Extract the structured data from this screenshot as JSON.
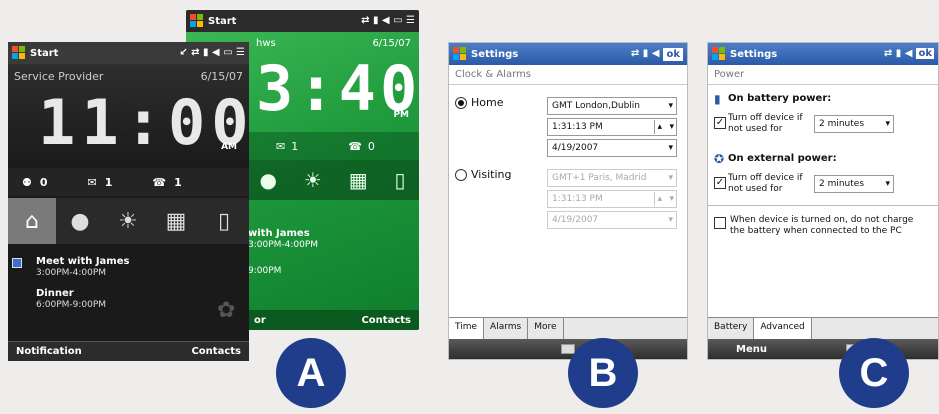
{
  "phoneA_back": {
    "title": "Start",
    "date": "6/15/07",
    "clock": "3:40",
    "clock_ampm": "PM",
    "sub_label": "hws",
    "counts": [
      "1",
      "0"
    ],
    "appt1": "with James",
    "appt1_time": "3:00PM-4:00PM",
    "appt2_time": "9:00PM",
    "soft_left": "or",
    "soft_right": "Contacts"
  },
  "phoneA_front": {
    "title": "Start",
    "provider": "Service Provider",
    "date": "6/15/07",
    "clock": "11:00",
    "clock_ampm": "AM",
    "counts": [
      "0",
      "1",
      "1"
    ],
    "appt1_title": "Meet with James",
    "appt1_time": "3:00PM-4:00PM",
    "appt2_title": "Dinner",
    "appt2_time": "6:00PM-9:00PM",
    "soft_left": "Notification",
    "soft_right": "Contacts"
  },
  "phoneB": {
    "title": "Settings",
    "ok": "ok",
    "crumb": "Clock & Alarms",
    "home_label": "Home",
    "home_tz": "GMT London,Dublin",
    "home_time": "1:31:13 PM",
    "home_date": "4/19/2007",
    "visit_label": "Visiting",
    "visit_tz": "GMT+1 Paris, Madrid",
    "visit_time": "1:31:13 PM",
    "visit_date": "4/19/2007",
    "tabs": [
      "Time",
      "Alarms",
      "More"
    ]
  },
  "phoneC": {
    "title": "Settings",
    "ok": "ok",
    "crumb": "Power",
    "battery_head": "On battery power:",
    "battery_text": "Turn off device if not used for",
    "battery_value": "2 minutes",
    "external_head": "On external power:",
    "external_text": "Turn off device if not used for",
    "external_value": "2 minutes",
    "charge_text": "When device is turned on, do not charge the battery when connected to the PC",
    "tabs": [
      "Battery",
      "Advanced"
    ],
    "soft_left": "Menu"
  },
  "labels": [
    "A",
    "B",
    "C"
  ]
}
